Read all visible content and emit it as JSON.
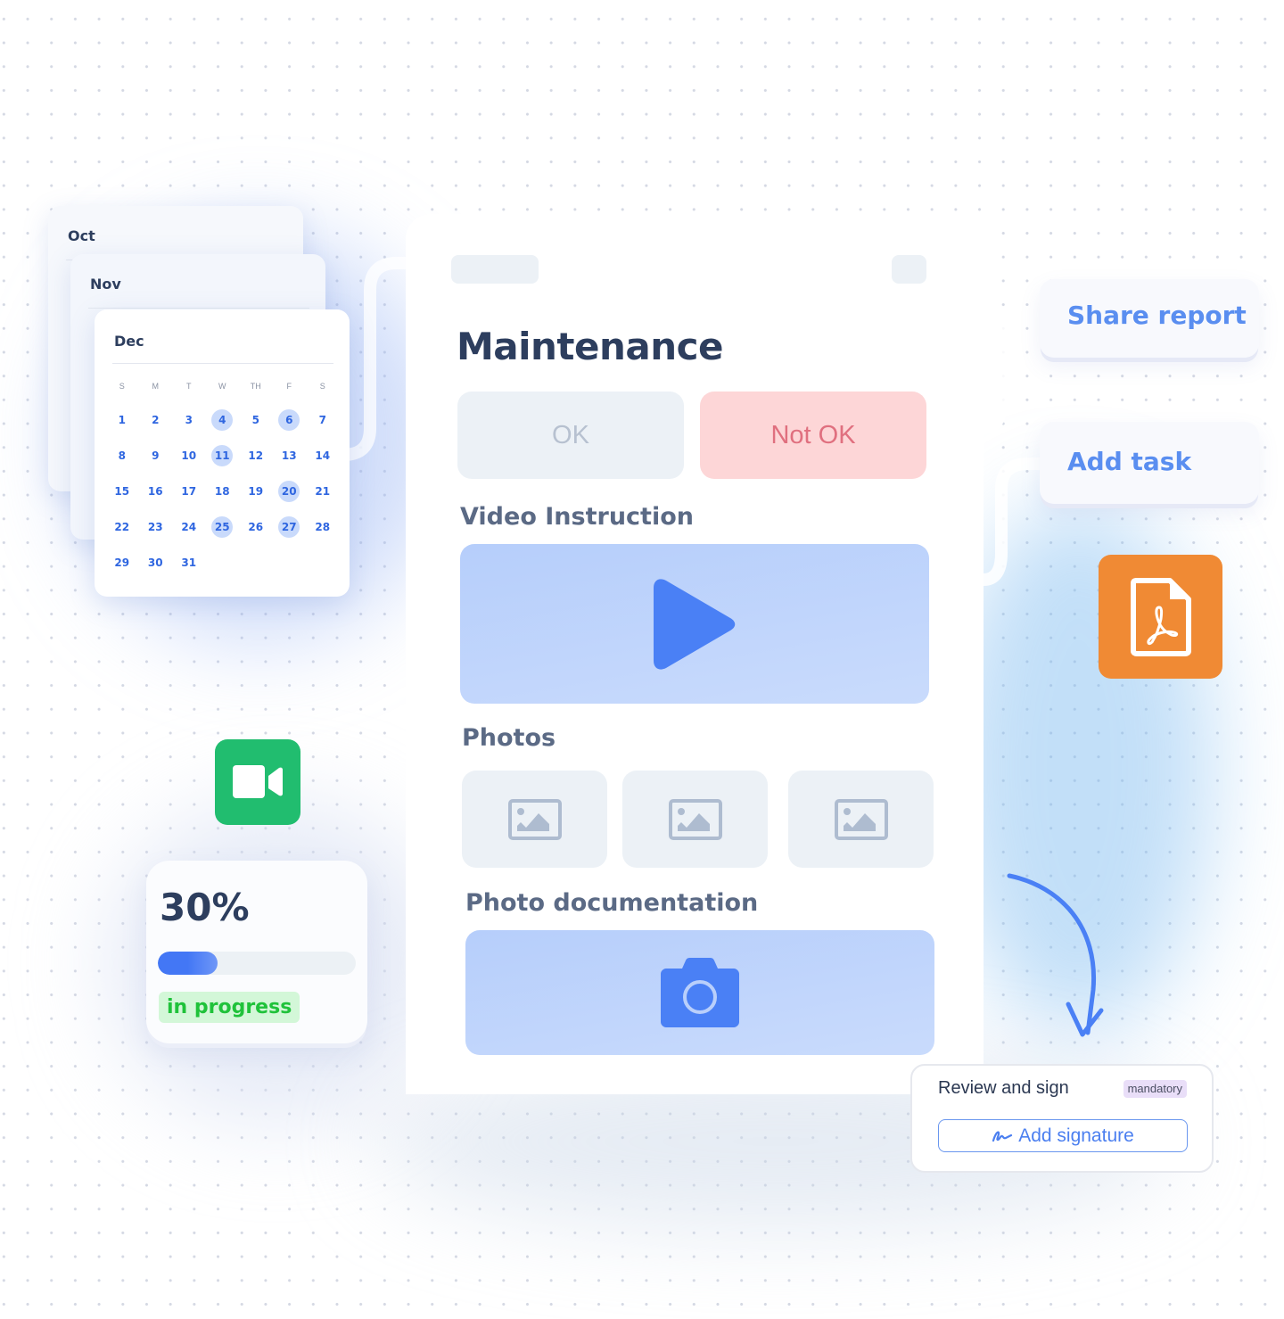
{
  "calendar": {
    "stack": [
      {
        "month": "Oct"
      },
      {
        "month": "Nov"
      },
      {
        "month": "Dec"
      }
    ],
    "active_month": "Dec",
    "weekdays": [
      "S",
      "M",
      "T",
      "W",
      "TH",
      "F",
      "S"
    ],
    "days": [
      1,
      2,
      3,
      4,
      5,
      6,
      7,
      8,
      9,
      10,
      11,
      12,
      13,
      14,
      15,
      16,
      17,
      18,
      19,
      20,
      21,
      22,
      23,
      24,
      25,
      26,
      27,
      28,
      29,
      30,
      31
    ],
    "highlighted_days": [
      4,
      6,
      11,
      20,
      25,
      27
    ],
    "accent_color": "#2f66e0",
    "highlight_color": "#c9dafb"
  },
  "main_card": {
    "title": "Maintenance",
    "choices": {
      "ok_label": "OK",
      "not_ok_label": "Not OK"
    },
    "video_section": {
      "label": "Video Instruction",
      "icon": "play-icon"
    },
    "photos_section": {
      "label": "Photos",
      "tiles": [
        {
          "icon": "image-placeholder-icon"
        },
        {
          "icon": "image-placeholder-icon"
        },
        {
          "icon": "image-placeholder-icon"
        }
      ]
    },
    "photo_doc_section": {
      "label": "Photo documentation",
      "icon": "camera-icon"
    }
  },
  "actions": {
    "share_report_label": "Share report",
    "add_task_label": "Add task",
    "pdf_icon": "pdf-file-icon",
    "video_call_icon": "video-camera-icon",
    "accent_color": "#5a8ef0"
  },
  "progress": {
    "value_label": "30%",
    "fraction": 0.3,
    "status": "in progress",
    "status_color": "#1fc23a"
  },
  "signature": {
    "title": "Review and sign",
    "badge": "mandatory",
    "button_label": "Add signature",
    "button_icon": "signature-icon"
  }
}
